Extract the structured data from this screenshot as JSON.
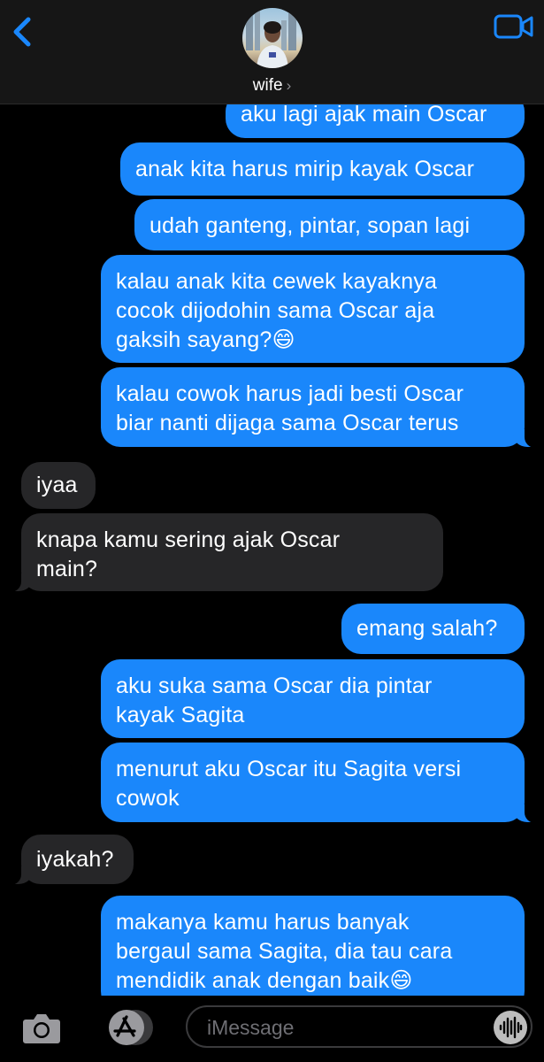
{
  "header": {
    "contact_name": "wife",
    "contact_chevron": "›",
    "back_icon": "chevron-left-icon",
    "video_icon": "video-camera-icon",
    "accent": "#1a87fb"
  },
  "messages": [
    {
      "from": "me",
      "text": "aku lagi ajak main Oscar"
    },
    {
      "from": "me",
      "text": "anak kita harus mirip kayak Oscar"
    },
    {
      "from": "me",
      "text": "udah ganteng, pintar, sopan lagi"
    },
    {
      "from": "me",
      "text": "kalau anak kita cewek kayaknya\ncocok dijodohin sama Oscar aja\ngaksih sayang?😄"
    },
    {
      "from": "me",
      "text": "kalau cowok harus jadi besti Oscar\nbiar nanti dijaga sama Oscar terus"
    },
    {
      "from": "them",
      "text": "iyaa"
    },
    {
      "from": "them",
      "text": "knapa kamu sering ajak Oscar\nmain?"
    },
    {
      "from": "me",
      "text": "emang salah?"
    },
    {
      "from": "me",
      "text": "aku suka sama Oscar dia pintar\nkayak Sagita"
    },
    {
      "from": "me",
      "text": "menurut aku Oscar itu Sagita versi\ncowok"
    },
    {
      "from": "them",
      "text": "iyakah?"
    },
    {
      "from": "me",
      "text": "makanya kamu harus banyak\nbergaul sama Sagita, dia tau cara\nmendidik anak dengan baik😄"
    }
  ],
  "composer": {
    "placeholder": "iMessage",
    "camera_icon": "camera-icon",
    "apps_icon": "app-store-icon",
    "audio_icon": "audio-waveform-icon"
  }
}
